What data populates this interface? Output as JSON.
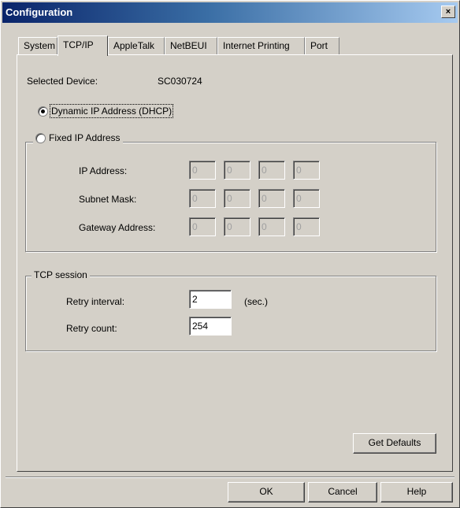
{
  "window": {
    "title": "Configuration",
    "close_glyph": "×"
  },
  "tabs": [
    {
      "label": "System",
      "active": false
    },
    {
      "label": "TCP/IP",
      "active": true
    },
    {
      "label": "AppleTalk",
      "active": false
    },
    {
      "label": "NetBEUI",
      "active": false
    },
    {
      "label": "Internet Printing",
      "active": false
    },
    {
      "label": "Port",
      "active": false
    }
  ],
  "device": {
    "label": "Selected Device:",
    "value": "SC030724"
  },
  "dhcp": {
    "label": "Dynamic IP Address (DHCP)",
    "checked": true
  },
  "fixed": {
    "label": "Fixed IP Address",
    "checked": false,
    "rows": [
      {
        "label": "IP Address:",
        "octets": [
          "0",
          "0",
          "0",
          "0"
        ]
      },
      {
        "label": "Subnet Mask:",
        "octets": [
          "0",
          "0",
          "0",
          "0"
        ]
      },
      {
        "label": "Gateway Address:",
        "octets": [
          "0",
          "0",
          "0",
          "0"
        ]
      }
    ]
  },
  "tcp_session": {
    "legend": "TCP session",
    "retry_interval": {
      "label": "Retry interval:",
      "value": "2",
      "unit": "(sec.)"
    },
    "retry_count": {
      "label": "Retry count:",
      "value": "254"
    }
  },
  "buttons": {
    "get_defaults": "Get Defaults",
    "ok": "OK",
    "cancel": "Cancel",
    "help": "Help"
  }
}
